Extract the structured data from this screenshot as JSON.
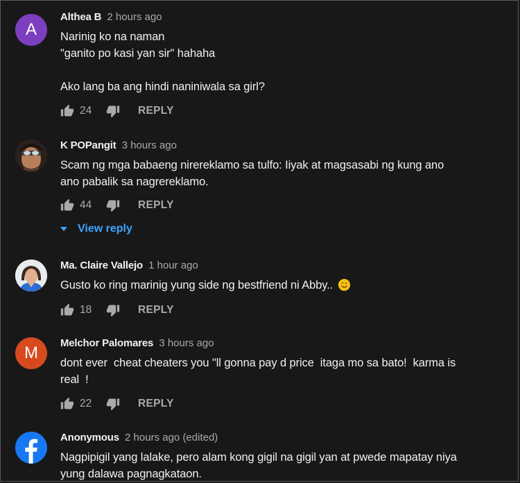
{
  "comments": [
    {
      "author": "Althea B",
      "time": "2 hours ago",
      "avatar": {
        "type": "letter",
        "letter": "A",
        "color": "#7b3fbf"
      },
      "lines": [
        "Narinig ko na naman",
        "\"ganito po kasi yan sir\" hahaha",
        "",
        "Ako lang ba ang hindi naniniwala sa girl?"
      ],
      "likes": "24",
      "reply_label": "REPLY"
    },
    {
      "author": "K POPangit",
      "time": "3 hours ago",
      "avatar": {
        "type": "photo",
        "desc": "person-photo"
      },
      "lines": [
        "Scam ng mga babaeng nirereklamo sa tulfo: Iiyak at magsasabi ng kung ano",
        "ano pabalik sa nagrereklamo."
      ],
      "likes": "44",
      "reply_label": "REPLY",
      "view_reply": "View reply"
    },
    {
      "author": "Ma. Claire Vallejo",
      "time": "1 hour ago",
      "avatar": {
        "type": "photo",
        "desc": "woman-photo"
      },
      "lines": [
        "Gusto ko ring marinig yung side ng bestfriend ni Abby.."
      ],
      "emoji": "smiling-face-emoji",
      "likes": "18",
      "reply_label": "REPLY"
    },
    {
      "author": "Melchor Palomares",
      "time": "3 hours ago",
      "avatar": {
        "type": "letter",
        "letter": "M",
        "color": "#d64a1e"
      },
      "lines": [
        "dont ever  cheat cheaters you \"ll gonna pay d price  itaga mo sa bato!  karma is",
        "real  !"
      ],
      "likes": "22",
      "reply_label": "REPLY"
    },
    {
      "author": "Anonymous",
      "time": "2 hours ago (edited)",
      "avatar": {
        "type": "logo",
        "desc": "facebook-logo",
        "color": "#1877f2"
      },
      "lines": [
        "Nagpipigil yang lalake, pero alam kong gigil na gigil yan at pwede mapatay niya",
        "yung dalawa pagnagkataon."
      ]
    }
  ],
  "colors": {
    "background": "#181818",
    "text": "#f1f1f1",
    "muted": "#aaaaaa",
    "link": "#3ea6ff"
  }
}
